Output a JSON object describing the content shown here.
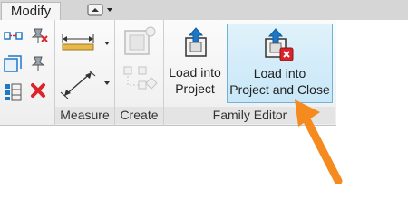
{
  "tabs": {
    "active": "Modify"
  },
  "panels": {
    "measure": "Measure",
    "create": "Create",
    "family_editor": "Family Editor"
  },
  "buttons": {
    "load_into_project": {
      "line1": "Load into",
      "line2": "Project"
    },
    "load_into_project_and_close": {
      "line1": "Load into",
      "line2": "Project and Close"
    }
  },
  "colors": {
    "highlight_fill": "#c8e7f7",
    "highlight_border": "#6fb3dc",
    "arrow": "#f58a1f",
    "delete_red": "#d9252a",
    "accent_blue": "#1e78c8"
  },
  "icons": {
    "align": "align-icon",
    "unpin": "unpin-icon",
    "offset": "offset-icon",
    "pin": "pin-icon",
    "array": "array-icon",
    "delete": "delete-icon",
    "measure_horizontal": "measure-ruler-icon",
    "measure_diagonal": "aligned-dimension-icon",
    "create_group": "create-group-icon",
    "create_similar": "create-similar-icon",
    "load_into_project": "load-into-project-icon",
    "load_into_project_and_close": "load-into-project-and-close-icon",
    "callout_arrow": "callout-arrow-icon"
  }
}
